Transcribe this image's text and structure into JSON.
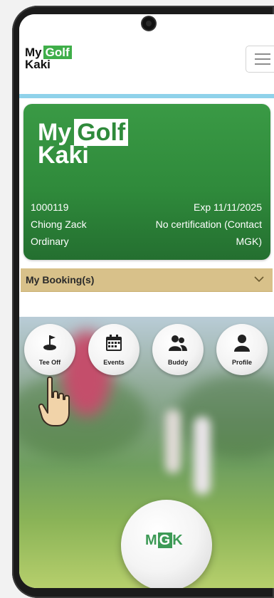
{
  "header": {
    "logo": {
      "line1": "My",
      "highlight": "Golf",
      "line2": "Kaki"
    }
  },
  "card": {
    "logo": {
      "line1": "My",
      "highlight": "Golf",
      "line2": "Kaki"
    },
    "member_id": "1000119",
    "expiry": "Exp 11/11/2025",
    "name": "Chiong Zack",
    "certification": "No certification (Contact",
    "membership_type": "Ordinary",
    "certification_cont": "MGK)",
    "color": "#2f8a3b"
  },
  "booking": {
    "title": "My Booking(s)",
    "color": "#d8c18a"
  },
  "actions": [
    {
      "label": "Tee Off",
      "icon": "golf-flag-icon"
    },
    {
      "label": "Events",
      "icon": "calendar-icon"
    },
    {
      "label": "Buddy",
      "icon": "people-icon"
    },
    {
      "label": "Profile",
      "icon": "user-icon"
    }
  ],
  "ball": {
    "logo_left": "M",
    "logo_mid": "G",
    "logo_right": "K"
  }
}
